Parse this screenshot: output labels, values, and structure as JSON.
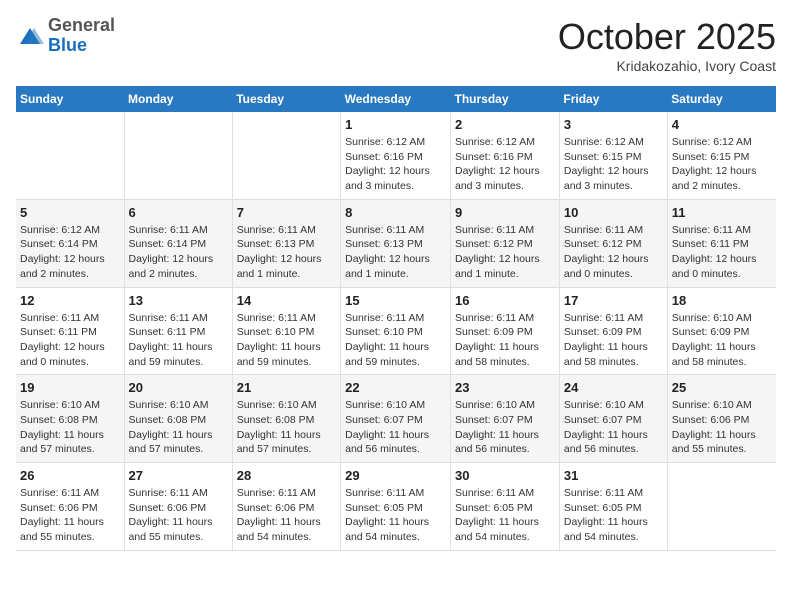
{
  "header": {
    "logo_general": "General",
    "logo_blue": "Blue",
    "month_title": "October 2025",
    "subtitle": "Kridakozahio, Ivory Coast"
  },
  "days_of_week": [
    "Sunday",
    "Monday",
    "Tuesday",
    "Wednesday",
    "Thursday",
    "Friday",
    "Saturday"
  ],
  "weeks": [
    [
      {
        "day": "",
        "info": ""
      },
      {
        "day": "",
        "info": ""
      },
      {
        "day": "",
        "info": ""
      },
      {
        "day": "1",
        "info": "Sunrise: 6:12 AM\nSunset: 6:16 PM\nDaylight: 12 hours and 3 minutes."
      },
      {
        "day": "2",
        "info": "Sunrise: 6:12 AM\nSunset: 6:16 PM\nDaylight: 12 hours and 3 minutes."
      },
      {
        "day": "3",
        "info": "Sunrise: 6:12 AM\nSunset: 6:15 PM\nDaylight: 12 hours and 3 minutes."
      },
      {
        "day": "4",
        "info": "Sunrise: 6:12 AM\nSunset: 6:15 PM\nDaylight: 12 hours and 2 minutes."
      }
    ],
    [
      {
        "day": "5",
        "info": "Sunrise: 6:12 AM\nSunset: 6:14 PM\nDaylight: 12 hours and 2 minutes."
      },
      {
        "day": "6",
        "info": "Sunrise: 6:11 AM\nSunset: 6:14 PM\nDaylight: 12 hours and 2 minutes."
      },
      {
        "day": "7",
        "info": "Sunrise: 6:11 AM\nSunset: 6:13 PM\nDaylight: 12 hours and 1 minute."
      },
      {
        "day": "8",
        "info": "Sunrise: 6:11 AM\nSunset: 6:13 PM\nDaylight: 12 hours and 1 minute."
      },
      {
        "day": "9",
        "info": "Sunrise: 6:11 AM\nSunset: 6:12 PM\nDaylight: 12 hours and 1 minute."
      },
      {
        "day": "10",
        "info": "Sunrise: 6:11 AM\nSunset: 6:12 PM\nDaylight: 12 hours and 0 minutes."
      },
      {
        "day": "11",
        "info": "Sunrise: 6:11 AM\nSunset: 6:11 PM\nDaylight: 12 hours and 0 minutes."
      }
    ],
    [
      {
        "day": "12",
        "info": "Sunrise: 6:11 AM\nSunset: 6:11 PM\nDaylight: 12 hours and 0 minutes."
      },
      {
        "day": "13",
        "info": "Sunrise: 6:11 AM\nSunset: 6:11 PM\nDaylight: 11 hours and 59 minutes."
      },
      {
        "day": "14",
        "info": "Sunrise: 6:11 AM\nSunset: 6:10 PM\nDaylight: 11 hours and 59 minutes."
      },
      {
        "day": "15",
        "info": "Sunrise: 6:11 AM\nSunset: 6:10 PM\nDaylight: 11 hours and 59 minutes."
      },
      {
        "day": "16",
        "info": "Sunrise: 6:11 AM\nSunset: 6:09 PM\nDaylight: 11 hours and 58 minutes."
      },
      {
        "day": "17",
        "info": "Sunrise: 6:11 AM\nSunset: 6:09 PM\nDaylight: 11 hours and 58 minutes."
      },
      {
        "day": "18",
        "info": "Sunrise: 6:10 AM\nSunset: 6:09 PM\nDaylight: 11 hours and 58 minutes."
      }
    ],
    [
      {
        "day": "19",
        "info": "Sunrise: 6:10 AM\nSunset: 6:08 PM\nDaylight: 11 hours and 57 minutes."
      },
      {
        "day": "20",
        "info": "Sunrise: 6:10 AM\nSunset: 6:08 PM\nDaylight: 11 hours and 57 minutes."
      },
      {
        "day": "21",
        "info": "Sunrise: 6:10 AM\nSunset: 6:08 PM\nDaylight: 11 hours and 57 minutes."
      },
      {
        "day": "22",
        "info": "Sunrise: 6:10 AM\nSunset: 6:07 PM\nDaylight: 11 hours and 56 minutes."
      },
      {
        "day": "23",
        "info": "Sunrise: 6:10 AM\nSunset: 6:07 PM\nDaylight: 11 hours and 56 minutes."
      },
      {
        "day": "24",
        "info": "Sunrise: 6:10 AM\nSunset: 6:07 PM\nDaylight: 11 hours and 56 minutes."
      },
      {
        "day": "25",
        "info": "Sunrise: 6:10 AM\nSunset: 6:06 PM\nDaylight: 11 hours and 55 minutes."
      }
    ],
    [
      {
        "day": "26",
        "info": "Sunrise: 6:11 AM\nSunset: 6:06 PM\nDaylight: 11 hours and 55 minutes."
      },
      {
        "day": "27",
        "info": "Sunrise: 6:11 AM\nSunset: 6:06 PM\nDaylight: 11 hours and 55 minutes."
      },
      {
        "day": "28",
        "info": "Sunrise: 6:11 AM\nSunset: 6:06 PM\nDaylight: 11 hours and 54 minutes."
      },
      {
        "day": "29",
        "info": "Sunrise: 6:11 AM\nSunset: 6:05 PM\nDaylight: 11 hours and 54 minutes."
      },
      {
        "day": "30",
        "info": "Sunrise: 6:11 AM\nSunset: 6:05 PM\nDaylight: 11 hours and 54 minutes."
      },
      {
        "day": "31",
        "info": "Sunrise: 6:11 AM\nSunset: 6:05 PM\nDaylight: 11 hours and 54 minutes."
      },
      {
        "day": "",
        "info": ""
      }
    ]
  ]
}
